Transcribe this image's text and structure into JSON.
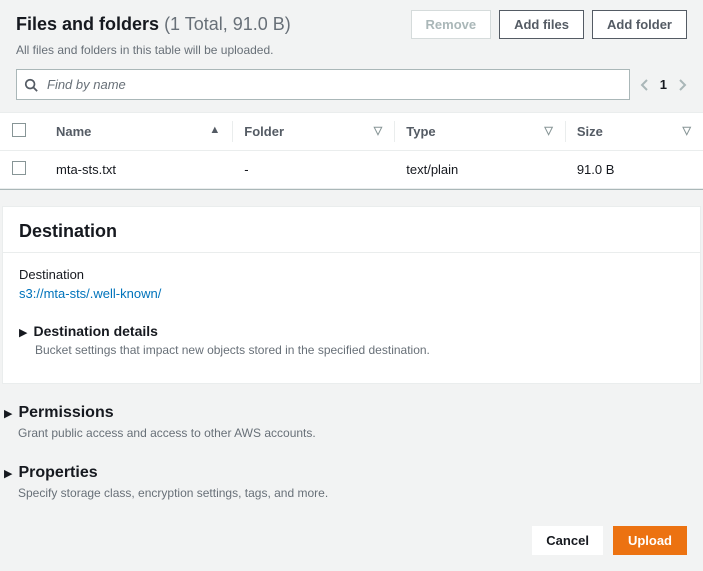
{
  "filesSection": {
    "title": "Files and folders",
    "count": "(1 Total, 91.0 B)",
    "subtitle": "All files and folders in this table will be uploaded.",
    "removeLabel": "Remove",
    "addFilesLabel": "Add files",
    "addFolderLabel": "Add folder"
  },
  "search": {
    "placeholder": "Find by name"
  },
  "pager": {
    "page": "1"
  },
  "table": {
    "headers": {
      "name": "Name",
      "folder": "Folder",
      "type": "Type",
      "size": "Size"
    },
    "rows": [
      {
        "name": "mta-sts.txt",
        "folder": "-",
        "type": "text/plain",
        "size": "91.0 B"
      }
    ]
  },
  "destination": {
    "heading": "Destination",
    "label": "Destination",
    "value": "s3://mta-sts/.well-known/",
    "detailsTitle": "Destination details",
    "detailsDesc": "Bucket settings that impact new objects stored in the specified destination."
  },
  "permissions": {
    "title": "Permissions",
    "desc": "Grant public access and access to other AWS accounts."
  },
  "properties": {
    "title": "Properties",
    "desc": "Specify storage class, encryption settings, tags, and more."
  },
  "footer": {
    "cancel": "Cancel",
    "upload": "Upload"
  }
}
